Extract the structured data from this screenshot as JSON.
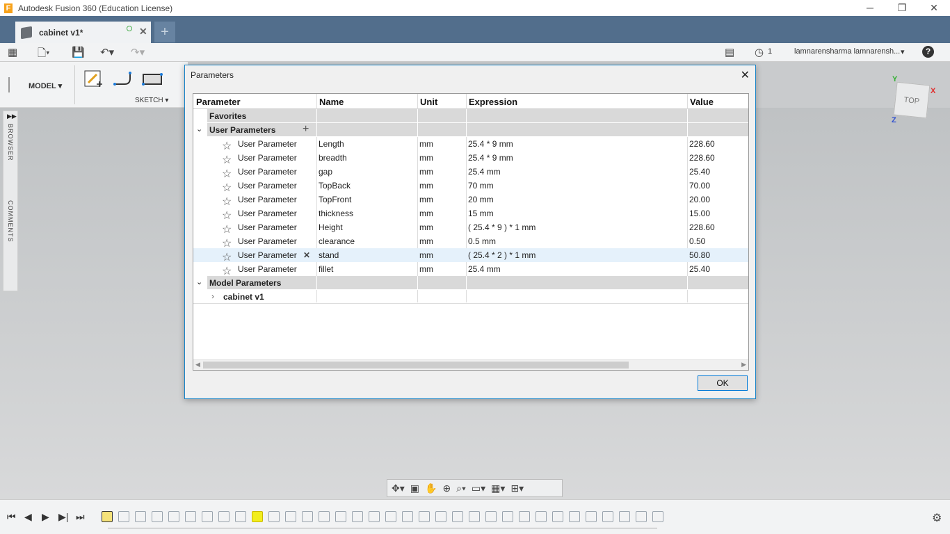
{
  "window": {
    "title": "Autodesk Fusion 360 (Education License)",
    "min": "─",
    "restore": "❐",
    "close": "✕"
  },
  "tab": {
    "label": "cabinet v1*",
    "close": "✕",
    "new": "+"
  },
  "qat": {
    "jobs_count": "1",
    "user": "lamnarensharma lamnarensh...",
    "user_caret": "▾",
    "help": "?"
  },
  "toolbar": {
    "workspace": "MODEL ▾",
    "sketch": "SKETCH ▾"
  },
  "browser": {
    "browser": "BROWSER",
    "comments": "COMMENTS"
  },
  "viewcube": {
    "face": "TOP",
    "x": "X",
    "y": "Y",
    "z": "Z"
  },
  "dialog": {
    "title": "Parameters",
    "close": "✕",
    "ok": "OK",
    "columns": [
      "Parameter",
      "Name",
      "Unit",
      "Expression",
      "Value"
    ],
    "favorites": "Favorites",
    "user_group": "User Parameters",
    "model_group": "Model Parameters",
    "model_child": "cabinet v1",
    "rows": [
      {
        "param": "User Parameter",
        "name": "Length",
        "unit": "mm",
        "expr": "25.4 * 9 mm",
        "value": "228.60"
      },
      {
        "param": "User Parameter",
        "name": "breadth",
        "unit": "mm",
        "expr": "25.4 * 9 mm",
        "value": "228.60"
      },
      {
        "param": "User Parameter",
        "name": "gap",
        "unit": "mm",
        "expr": "25.4 mm",
        "value": "25.40"
      },
      {
        "param": "User Parameter",
        "name": "TopBack",
        "unit": "mm",
        "expr": "70 mm",
        "value": "70.00"
      },
      {
        "param": "User Parameter",
        "name": "TopFront",
        "unit": "mm",
        "expr": "20 mm",
        "value": "20.00"
      },
      {
        "param": "User Parameter",
        "name": "thickness",
        "unit": "mm",
        "expr": "15 mm",
        "value": "15.00"
      },
      {
        "param": "User Parameter",
        "name": "Height",
        "unit": "mm",
        "expr": "( 25.4 * 9 ) * 1 mm",
        "value": "228.60"
      },
      {
        "param": "User Parameter",
        "name": "clearance",
        "unit": "mm",
        "expr": "0.5 mm",
        "value": "0.50"
      },
      {
        "param": "User Parameter",
        "name": "stand",
        "unit": "mm",
        "expr": "( 25.4 * 2 ) * 1 mm",
        "value": "50.80"
      },
      {
        "param": "User Parameter",
        "name": "fillet",
        "unit": "mm",
        "expr": "25.4 mm",
        "value": "25.40"
      }
    ]
  }
}
